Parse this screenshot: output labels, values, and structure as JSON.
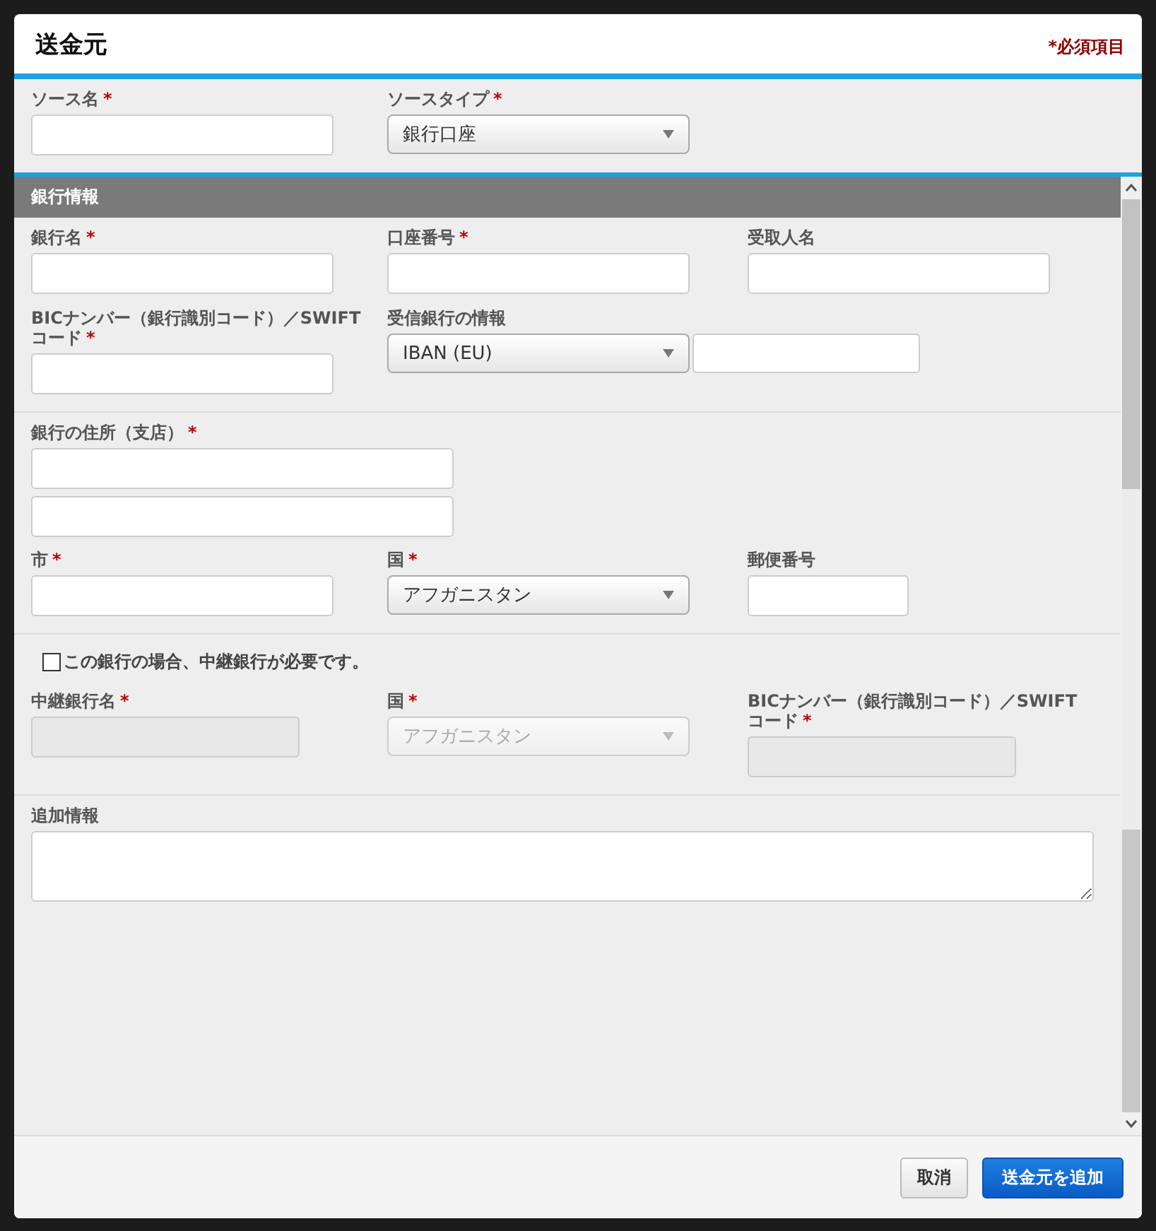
{
  "dialog": {
    "title": "送金元",
    "required_note": "*必須項目"
  },
  "source": [
    {
      "label": "ソース名",
      "mark": "*",
      "kind": "text"
    },
    {
      "label": "ソースタイプ",
      "mark": "*",
      "kind": "select",
      "value": "銀行口座"
    }
  ],
  "section": {
    "title": "銀行情報"
  },
  "groups": [
    {
      "rows": [
        [
          {
            "label": "銀行名",
            "mark": "*",
            "kind": "text"
          },
          {
            "label": "口座番号",
            "mark": "*",
            "kind": "text"
          },
          {
            "label": "受取人名",
            "kind": "text"
          }
        ],
        [
          {
            "label": "BICナンバー（銀行識別コード）／SWIFT コード",
            "mark": "*",
            "kind": "text"
          },
          {
            "label": "受信銀行の情報",
            "kind": "select-text",
            "value": "IBAN (EU)"
          }
        ]
      ]
    },
    {
      "rows": [
        [
          {
            "label": "銀行の住所（支店）",
            "mark": "*",
            "kind": "double-text"
          }
        ],
        [
          {
            "label": "市",
            "mark": "*",
            "kind": "text"
          },
          {
            "label": "国",
            "mark": "*",
            "kind": "select",
            "value": "アフガニスタン"
          },
          {
            "label": "郵便番号",
            "kind": "short-text"
          }
        ]
      ]
    },
    {
      "checkbox": {
        "label": "この銀行の場合、中継銀行が必要です。",
        "checked": false
      },
      "rows": [
        [
          {
            "label": "中継銀行名",
            "mark": "*",
            "kind": "text",
            "disabled": true
          },
          {
            "label": "国",
            "mark": "*",
            "kind": "select",
            "value": "アフガニスタン",
            "disabled": true
          },
          {
            "label": "BICナンバー（銀行識別コード）／SWIFT コード",
            "mark": "*",
            "kind": "text",
            "disabled": true
          }
        ]
      ]
    },
    {
      "rows": [
        [
          {
            "label": "追加情報",
            "kind": "textarea"
          }
        ]
      ]
    }
  ],
  "buttons": [
    {
      "label": "取消",
      "kind": "secondary"
    },
    {
      "label": "送金元を追加",
      "kind": "primary"
    }
  ]
}
